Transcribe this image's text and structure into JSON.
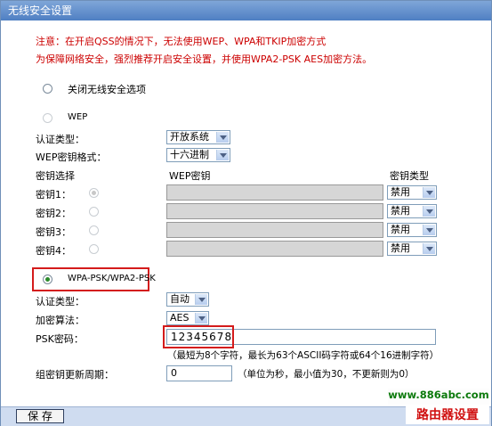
{
  "title": "无线安全设置",
  "notes": {
    "line1": "注意：在开启QSS的情况下，无法使用WEP、WPA和TKIP加密方式",
    "line2": "为保障网络安全，强烈推荐开启安全设置，并使用WPA2-PSK AES加密方法。"
  },
  "options": {
    "disable_label": "关闭无线安全选项",
    "wep_label": "WEP",
    "wpa_label": "WPA-PSK/WPA2-PSK"
  },
  "wep": {
    "auth_label": "认证类型：",
    "auth_value": "开放系统",
    "format_label": "WEP密钥格式：",
    "format_value": "十六进制",
    "col_select": "密钥选择",
    "col_key": "WEP密钥",
    "col_type": "密钥类型",
    "keys": [
      {
        "label": "密钥1：",
        "type": "禁用"
      },
      {
        "label": "密钥2：",
        "type": "禁用"
      },
      {
        "label": "密钥3：",
        "type": "禁用"
      },
      {
        "label": "密钥4：",
        "type": "禁用"
      }
    ]
  },
  "wpa": {
    "auth_label": "认证类型：",
    "auth_value": "自动",
    "enc_label": "加密算法：",
    "enc_value": "AES",
    "psk_label": "PSK密码：",
    "psk_value": "12345678",
    "psk_hint": "（最短为8个字符，最长为63个ASCII码字符或64个16进制字符）",
    "rekey_label": "组密钥更新周期：",
    "rekey_value": "0",
    "rekey_hint": "（单位为秒，最小值为30，不更新则为0）"
  },
  "save_label": "保 存",
  "watermark": {
    "url": "www.886abc.com",
    "name": "路由器设置"
  },
  "colors": {
    "accent_red": "#cc0000",
    "titlebar": "#4f7fc3"
  }
}
